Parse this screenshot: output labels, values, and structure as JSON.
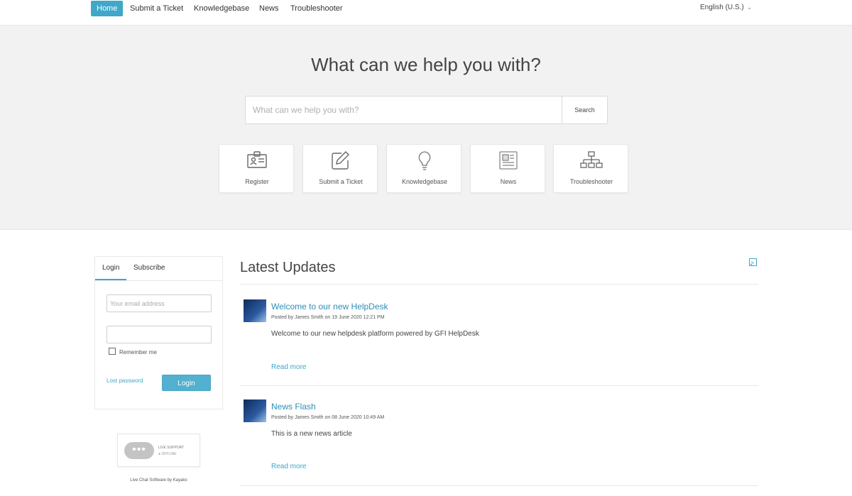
{
  "nav": {
    "items": [
      {
        "label": "Home",
        "active": true
      },
      {
        "label": "Submit a Ticket",
        "active": false
      },
      {
        "label": "Knowledgebase",
        "active": false
      },
      {
        "label": "News",
        "active": false
      },
      {
        "label": "Troubleshooter",
        "active": false
      }
    ],
    "language": "English (U.S.)",
    "accent_color": "#3fa7c8"
  },
  "hero": {
    "title": "What can we help you with?",
    "search_placeholder": "What can we help you with?",
    "search_button": "Search",
    "tiles": [
      {
        "label": "Register",
        "icon": "id-card-icon"
      },
      {
        "label": "Submit a Ticket",
        "icon": "edit-icon"
      },
      {
        "label": "Knowledgebase",
        "icon": "lightbulb-icon"
      },
      {
        "label": "News",
        "icon": "newspaper-icon"
      },
      {
        "label": "Troubleshooter",
        "icon": "sitemap-icon"
      }
    ]
  },
  "login": {
    "tabs": [
      "Login",
      "Subscribe"
    ],
    "active_tab": "Login",
    "email_placeholder": "Your email address",
    "password_placeholder": "",
    "remember_label": "Remember me",
    "lost_password": "Lost password",
    "login_button": "Login"
  },
  "live_chat": {
    "status_line1": "LIVE SUPPORT",
    "status_line2": "● OFFLINE",
    "credit": "Live Chat Software by Kayako"
  },
  "updates": {
    "title": "Latest Updates",
    "articles": [
      {
        "title": "Welcome to our new HelpDesk",
        "meta": "Posted by James Smith on 19 June 2020 12:21 PM",
        "body": "Welcome to our new helpdesk platform powered by GFI HelpDesk",
        "read_more": "Read more"
      },
      {
        "title": "News Flash",
        "meta": "Posted by James Smith on 08 June 2020 10:49 AM",
        "body": "This is a new news article",
        "read_more": "Read more"
      }
    ]
  }
}
